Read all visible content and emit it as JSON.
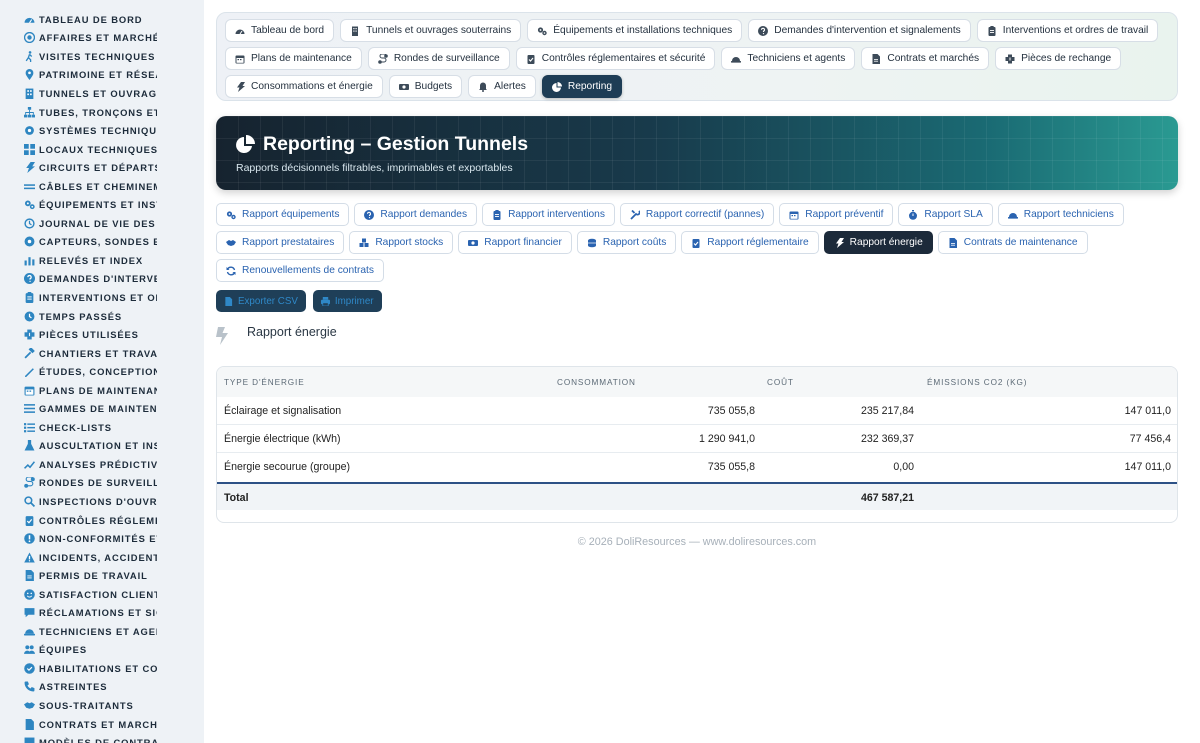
{
  "sidebar": {
    "items": [
      {
        "label": "TABLEAU DE BORD",
        "icon": "dashboard-icon"
      },
      {
        "label": "AFFAIRES ET MARCHÉS",
        "icon": "target-icon"
      },
      {
        "label": "VISITES TECHNIQUES ET",
        "icon": "walk-icon"
      },
      {
        "label": "PATRIMOINE ET RÉSEAUX",
        "icon": "map-pin-icon"
      },
      {
        "label": "TUNNELS ET OUVRAGES",
        "icon": "tunnel-icon"
      },
      {
        "label": "TUBES, TRONÇONS ET ZO",
        "icon": "sitemap-icon"
      },
      {
        "label": "SYSTÈMES TECHNIQUES",
        "icon": "cogs-icon"
      },
      {
        "label": "LOCAUX TECHNIQUES ET",
        "icon": "grid-icon"
      },
      {
        "label": "CIRCUITS ET DÉPARTS É",
        "icon": "bolt-icon"
      },
      {
        "label": "CÂBLES ET CHEMINEMENT",
        "icon": "lines-icon"
      },
      {
        "label": "ÉQUIPEMENTS ET INSTAL",
        "icon": "gears-icon"
      },
      {
        "label": "JOURNAL DE VIE DES ÉQ",
        "icon": "history-icon"
      },
      {
        "label": "CAPTEURS, SONDES ET C",
        "icon": "sensor-icon"
      },
      {
        "label": "RELEVÉS ET INDEX",
        "icon": "chart-icon"
      },
      {
        "label": "DEMANDES D'INTERVENT",
        "icon": "question-icon"
      },
      {
        "label": "INTERVENTIONS ET ORDI",
        "icon": "clipboard-icon"
      },
      {
        "label": "TEMPS PASSÉS",
        "icon": "clock-icon"
      },
      {
        "label": "PIÈCES UTILISÉES",
        "icon": "puzzle-icon"
      },
      {
        "label": "CHANTIERS ET TRAVAUX",
        "icon": "hammer-icon"
      },
      {
        "label": "ÉTUDES, CONCEPTION ET",
        "icon": "pencil-ruler-icon"
      },
      {
        "label": "PLANS DE MAINTENANCE",
        "icon": "calendar-icon"
      },
      {
        "label": "GAMMES DE MAINTENAN",
        "icon": "list-icon"
      },
      {
        "label": "CHECK-LISTS",
        "icon": "checklist-icon"
      },
      {
        "label": "AUSCULTATION ET INSTR",
        "icon": "flask-icon"
      },
      {
        "label": "ANALYSES PRÉDICTIVES",
        "icon": "trend-icon"
      },
      {
        "label": "RONDES DE SURVEILLAN",
        "icon": "route-icon"
      },
      {
        "label": "INSPECTIONS D'OUVRAG",
        "icon": "search-icon"
      },
      {
        "label": "CONTRÔLES RÉGLEMENT",
        "icon": "clipboard-check-icon"
      },
      {
        "label": "NON-CONFORMITÉS ET A",
        "icon": "alert-circle-icon"
      },
      {
        "label": "INCIDENTS, ACCIDENTS E",
        "icon": "warning-icon"
      },
      {
        "label": "PERMIS DE TRAVAIL",
        "icon": "file-icon"
      },
      {
        "label": "SATISFACTION CLIENT",
        "icon": "smile-icon"
      },
      {
        "label": "RÉCLAMATIONS ET SIGNA",
        "icon": "comment-icon"
      },
      {
        "label": "TECHNICIENS ET AGENTS",
        "icon": "hardhat-icon"
      },
      {
        "label": "ÉQUIPES",
        "icon": "users-icon"
      },
      {
        "label": "HABILITATIONS ET COMP",
        "icon": "badge-icon"
      },
      {
        "label": "ASTREINTES",
        "icon": "phone-icon"
      },
      {
        "label": "SOUS-TRAITANTS",
        "icon": "handshake-icon"
      },
      {
        "label": "CONTRATS ET MARCHÉS",
        "icon": "contract-icon"
      },
      {
        "label": "MODÈLES DE CONTRATS",
        "icon": "template-icon"
      }
    ]
  },
  "topnav": {
    "rows": [
      [
        {
          "label": "Tableau de bord",
          "icon": "gauge-icon"
        },
        {
          "label": "Tunnels et ouvrages souterrains",
          "icon": "building-icon"
        },
        {
          "label": "Équipements et installations techniques",
          "icon": "gears-icon"
        },
        {
          "label": "Demandes d'intervention et signalements",
          "icon": "question-icon"
        },
        {
          "label": "Interventions et ordres de travail",
          "icon": "clipboard-icon"
        }
      ],
      [
        {
          "label": "Plans de maintenance",
          "icon": "calendar-icon"
        },
        {
          "label": "Rondes de surveillance",
          "icon": "route-icon"
        },
        {
          "label": "Contrôles réglementaires et sécurité",
          "icon": "clipboard-check-icon"
        },
        {
          "label": "Techniciens et agents",
          "icon": "hardhat-icon"
        },
        {
          "label": "Contrats et marchés",
          "icon": "file-icon"
        },
        {
          "label": "Pièces de rechange",
          "icon": "puzzle-icon"
        }
      ],
      [
        {
          "label": "Consommations et énergie",
          "icon": "bolt-icon"
        },
        {
          "label": "Budgets",
          "icon": "money-icon"
        },
        {
          "label": "Alertes",
          "icon": "bell-icon"
        },
        {
          "label": "Reporting",
          "icon": "pie-icon",
          "active": true
        }
      ]
    ]
  },
  "hero": {
    "title": "Reporting – Gestion Tunnels",
    "subtitle": "Rapports décisionnels filtrables, imprimables et exportables"
  },
  "reports": {
    "rows": [
      [
        {
          "label": "Rapport équipements",
          "icon": "gears-icon"
        },
        {
          "label": "Rapport demandes",
          "icon": "question-icon"
        },
        {
          "label": "Rapport interventions",
          "icon": "clipboard-icon"
        },
        {
          "label": "Rapport correctif (pannes)",
          "icon": "tools-icon"
        },
        {
          "label": "Rapport préventif",
          "icon": "calendar-icon"
        },
        {
          "label": "Rapport SLA",
          "icon": "stopwatch-icon"
        },
        {
          "label": "Rapport techniciens",
          "icon": "hardhat-icon"
        }
      ],
      [
        {
          "label": "Rapport prestataires",
          "icon": "handshake-icon"
        },
        {
          "label": "Rapport stocks",
          "icon": "boxes-icon"
        },
        {
          "label": "Rapport financier",
          "icon": "money-icon"
        },
        {
          "label": "Rapport coûts",
          "icon": "coins-icon"
        },
        {
          "label": "Rapport réglementaire",
          "icon": "clipboard-check-icon"
        },
        {
          "label": "Rapport énergie",
          "icon": "bolt-icon",
          "active": true
        },
        {
          "label": "Contrats de maintenance",
          "icon": "file-icon"
        }
      ],
      [
        {
          "label": "Renouvellements de contrats",
          "icon": "sync-icon"
        }
      ]
    ]
  },
  "export": {
    "csv_label": "Exporter CSV",
    "print_label": "Imprimer"
  },
  "section": {
    "title": "Rapport énergie"
  },
  "table": {
    "headers": [
      "TYPE D'ÉNERGIE",
      "CONSOMMATION",
      "COÛT",
      "ÉMISSIONS CO2 (KG)"
    ],
    "rows": [
      {
        "type": "Éclairage et signalisation",
        "consumption": "735 055,8",
        "cost": "235 217,84",
        "emissions": "147 011,0"
      },
      {
        "type": "Énergie électrique (kWh)",
        "consumption": "1 290 941,0",
        "cost": "232 369,37",
        "emissions": "77 456,4"
      },
      {
        "type": "Énergie secourue (groupe)",
        "consumption": "735 055,8",
        "cost": "0,00",
        "emissions": "147 011,0"
      }
    ],
    "total_label": "Total",
    "total_cost": "467 587,21"
  },
  "footer": {
    "text": "© 2026 DoliResources — www.doliresources.com"
  },
  "colors": {
    "accent": "#2a63b0",
    "active_dark": "#1c2a3a",
    "sidebar_icon": "#2e86c1"
  }
}
